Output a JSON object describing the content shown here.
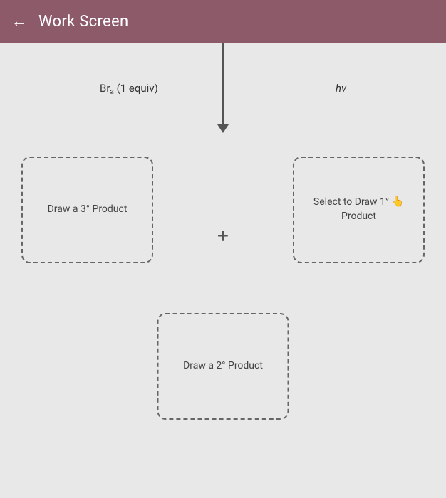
{
  "header": {
    "title": "Work Screen",
    "back_label": "←"
  },
  "labels": {
    "br2": "Br₂ (1 equiv)",
    "hv": "hv",
    "plus": "+",
    "box_left": "Draw a 3° Product",
    "box_right_line1": "Select to Draw 1°",
    "box_right_line2": "Product",
    "box_bottom": "Draw a 2° Product"
  }
}
